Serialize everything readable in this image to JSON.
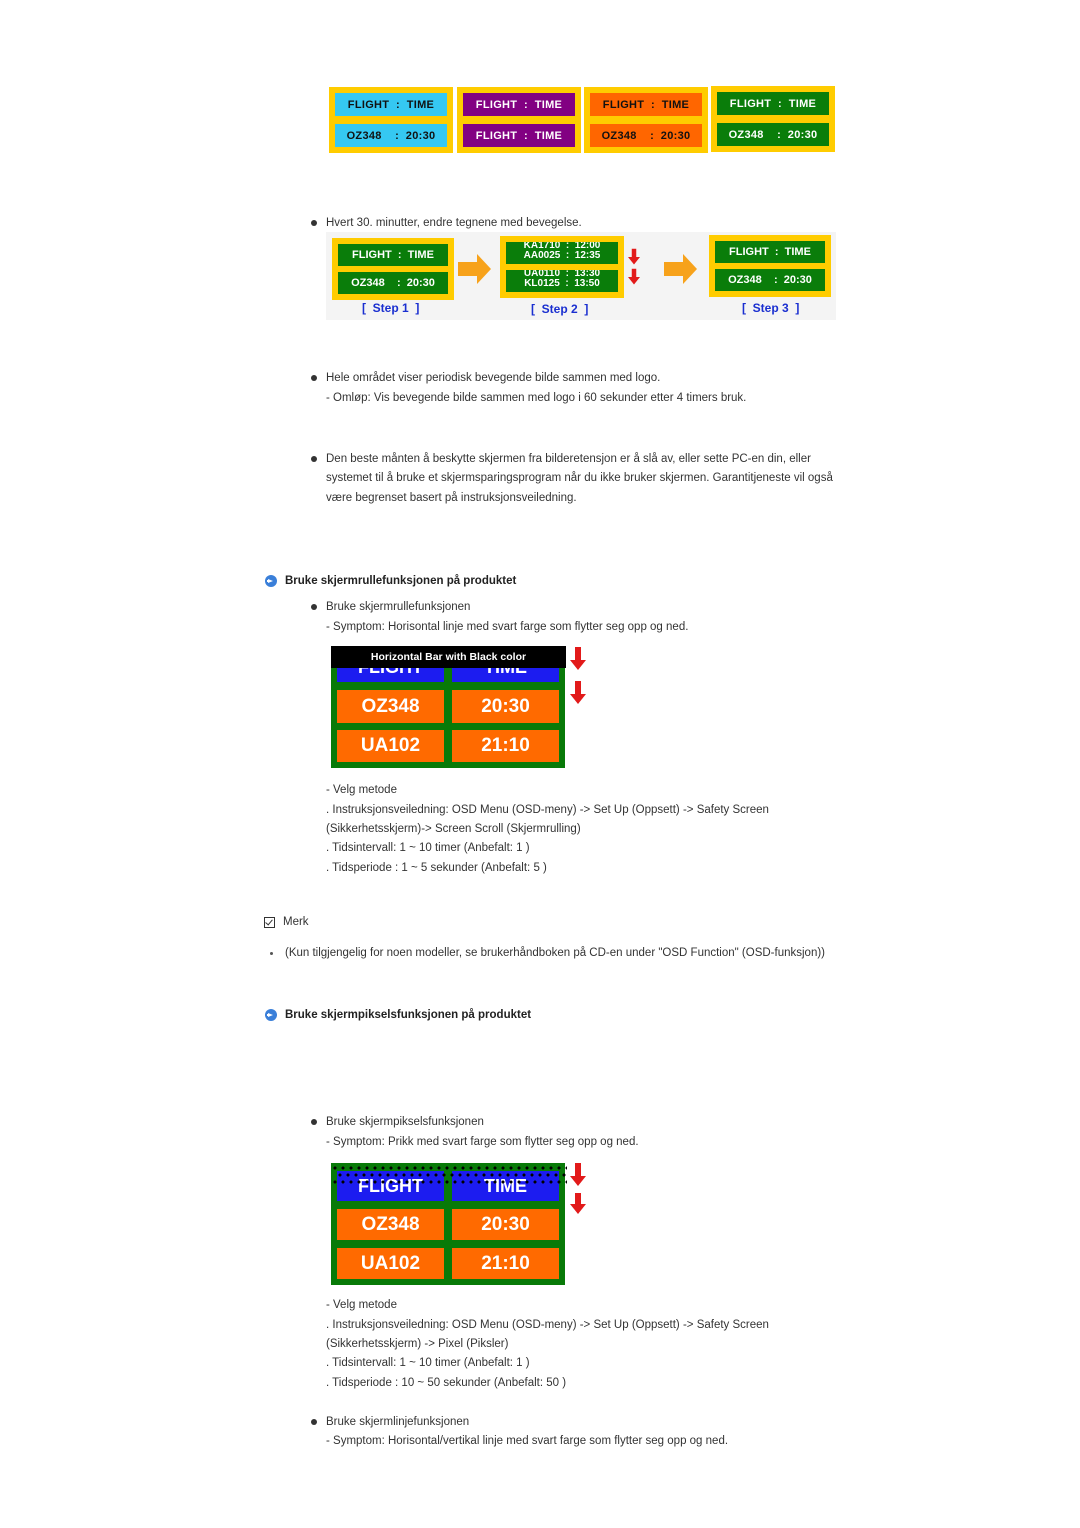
{
  "top_panels": [
    {
      "row1": "FLIGHT  :  TIME",
      "row2": "OZ348    :  20:30",
      "bg": "#35c8f2",
      "fg": "#111111"
    },
    {
      "row1": "FLIGHT  :  TIME",
      "row2": "FLIGHT  :  TIME",
      "bg": "#820082",
      "fg": "#ffffff"
    },
    {
      "row1": "FLIGHT  :  TIME",
      "row2": "OZ348    :  20:30",
      "bg": "#ff6600",
      "fg": "#111111"
    },
    {
      "row1": "FLIGHT  :  TIME",
      "row2": "OZ348    :  20:30",
      "bg": "#0a7d0a",
      "fg": "#ffffff"
    }
  ],
  "section1": {
    "bullet1": "Hvert 30. minutter, endre tegnene med bevegelse.",
    "steps": [
      {
        "label": "[  Step 1  ]",
        "row1": "FLIGHT  :  TIME",
        "row2": "OZ348    :  20:30"
      },
      {
        "label": "[  Step 2  ]",
        "row1a": "KA1710  :  12:00",
        "row1b": "AA0025  :  12:35",
        "row2a": "UA0110  :  13:30",
        "row2b": "KL0125  :  13:50"
      },
      {
        "label": "[  Step 3  ]",
        "row1": "FLIGHT  :  TIME",
        "row2": "OZ348    :  20:30"
      }
    ],
    "bullet2": "Hele området viser periodisk bevegende bilde sammen med logo.",
    "bullet2_sub": "- Omløp: Vis bevegende bilde sammen med logo i 60 sekunder etter 4 timers bruk.",
    "bullet3_lines": [
      "Den beste månten å beskytte skjermen fra bilderetensjon er å slå av, eller sette PC-en din, eller",
      "systemet til å bruke et skjermsparingsprogram når du ikke bruker skjermen. Garantitjeneste vil også",
      "være begrenset basert på instruksjonsveiledning."
    ]
  },
  "scroll_section": {
    "heading": "Bruke skjermrullefunksjonen på produktet",
    "bullet": "Bruke skjermrullefunksjonen",
    "symptom": "- Symptom: Horisontal linje med svart farge som flytter seg opp og ned.",
    "board": {
      "bar_label": "Horizontal Bar with Black color",
      "header": [
        "FLIGHT",
        "TIME"
      ],
      "rows": [
        [
          "OZ348",
          "20:30"
        ],
        [
          "UA102",
          "21:10"
        ]
      ]
    },
    "method_lines": [
      "- Velg metode",
      ". Instruksjonsveiledning: OSD Menu (OSD-meny) -> Set Up (Oppsett) -> Safety Screen",
      "(Sikkerhetsskjerm)-> Screen Scroll (Skjermrulling)",
      ". Tidsintervall: 1 ~ 10 timer (Anbefalt: 1 )",
      ". Tidsperiode : 1 ~ 5 sekunder (Anbefalt: 5 )"
    ]
  },
  "note": {
    "label": "Merk",
    "text": "(Kun tilgjengelig for noen modeller, se brukerhåndboken på CD-en under \"OSD Function\" (OSD-funksjon))"
  },
  "pixel_section": {
    "heading": "Bruke skjermpikselsfunksjonen på produktet",
    "bullet": "Bruke skjermpikselsfunksjonen",
    "symptom": "- Symptom: Prikk med svart farge som flytter seg opp og ned.",
    "board": {
      "header": [
        "FLIGHT",
        "TIME"
      ],
      "rows": [
        [
          "OZ348",
          "20:30"
        ],
        [
          "UA102",
          "21:10"
        ]
      ]
    },
    "method_lines": [
      "- Velg metode",
      ". Instruksjonsveiledning: OSD Menu (OSD-meny) -> Set Up (Oppsett) -> Safety Screen",
      "(Sikkerhetsskjerm) -> Pixel (Piksler)",
      ". Tidsintervall: 1 ~ 10 timer (Anbefalt: 1 )",
      ". Tidsperiode : 10 ~ 50 sekunder (Anbefalt: 50 )"
    ]
  },
  "line_section": {
    "bullet": "Bruke skjermlinjefunksjonen",
    "symptom": "- Symptom: Horisontal/vertikal linje med svart farge som flytter seg opp og ned."
  }
}
